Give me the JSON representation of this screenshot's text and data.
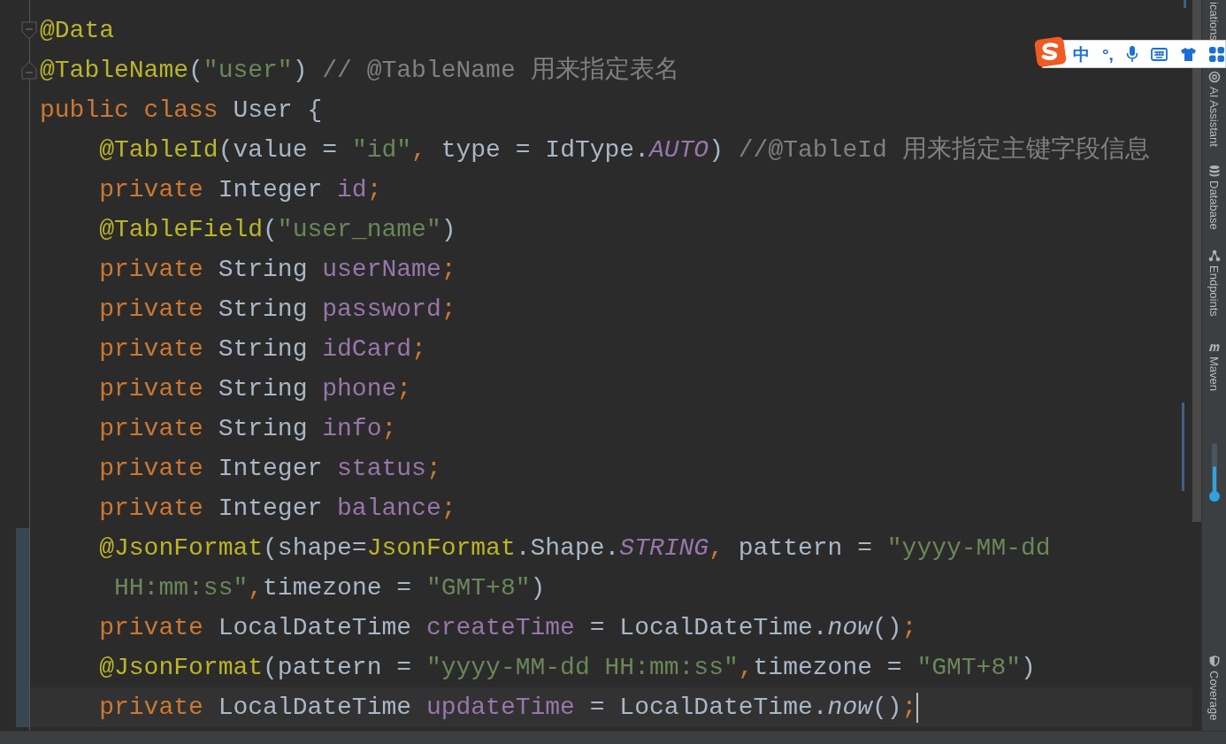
{
  "editor": {
    "lines": [
      {
        "tokens": [
          {
            "text": "@Data",
            "kind": "annotation"
          }
        ]
      },
      {
        "tokens": [
          {
            "text": "@TableName",
            "kind": "annotation"
          },
          {
            "text": "(",
            "kind": "plain"
          },
          {
            "text": "\"user\"",
            "kind": "string"
          },
          {
            "text": ") ",
            "kind": "plain"
          },
          {
            "text": "// @TableName 用来指定表名",
            "kind": "comment"
          }
        ]
      },
      {
        "tokens": [
          {
            "text": "public class ",
            "kind": "keyword"
          },
          {
            "text": "User {",
            "kind": "plain"
          }
        ]
      },
      {
        "tokens": [
          {
            "text": "    @TableId",
            "kind": "annotation"
          },
          {
            "text": "(value = ",
            "kind": "plain"
          },
          {
            "text": "\"id\"",
            "kind": "string"
          },
          {
            "text": ", ",
            "kind": "keyword"
          },
          {
            "text": "type = IdType.",
            "kind": "plain"
          },
          {
            "text": "AUTO",
            "kind": "constant"
          },
          {
            "text": ") ",
            "kind": "plain"
          },
          {
            "text": "//@TableId 用来指定主键字段信息",
            "kind": "comment"
          }
        ]
      },
      {
        "tokens": [
          {
            "text": "    private ",
            "kind": "keyword"
          },
          {
            "text": "Integer ",
            "kind": "plain"
          },
          {
            "text": "id",
            "kind": "field"
          },
          {
            "text": ";",
            "kind": "keyword"
          }
        ]
      },
      {
        "tokens": [
          {
            "text": "    @TableField",
            "kind": "annotation"
          },
          {
            "text": "(",
            "kind": "plain"
          },
          {
            "text": "\"user_name\"",
            "kind": "string"
          },
          {
            "text": ")",
            "kind": "plain"
          }
        ]
      },
      {
        "tokens": [
          {
            "text": "    private ",
            "kind": "keyword"
          },
          {
            "text": "String ",
            "kind": "plain"
          },
          {
            "text": "userName",
            "kind": "field"
          },
          {
            "text": ";",
            "kind": "keyword"
          }
        ]
      },
      {
        "tokens": [
          {
            "text": "    private ",
            "kind": "keyword"
          },
          {
            "text": "String ",
            "kind": "plain"
          },
          {
            "text": "password",
            "kind": "field"
          },
          {
            "text": ";",
            "kind": "keyword"
          }
        ]
      },
      {
        "tokens": [
          {
            "text": "    private ",
            "kind": "keyword"
          },
          {
            "text": "String ",
            "kind": "plain"
          },
          {
            "text": "idCard",
            "kind": "field"
          },
          {
            "text": ";",
            "kind": "keyword"
          }
        ]
      },
      {
        "tokens": [
          {
            "text": "    private ",
            "kind": "keyword"
          },
          {
            "text": "String ",
            "kind": "plain"
          },
          {
            "text": "phone",
            "kind": "field"
          },
          {
            "text": ";",
            "kind": "keyword"
          }
        ]
      },
      {
        "tokens": [
          {
            "text": "    private ",
            "kind": "keyword"
          },
          {
            "text": "String ",
            "kind": "plain"
          },
          {
            "text": "info",
            "kind": "field"
          },
          {
            "text": ";",
            "kind": "keyword"
          }
        ]
      },
      {
        "tokens": [
          {
            "text": "    private ",
            "kind": "keyword"
          },
          {
            "text": "Integer ",
            "kind": "plain"
          },
          {
            "text": "status",
            "kind": "field"
          },
          {
            "text": ";",
            "kind": "keyword"
          }
        ]
      },
      {
        "tokens": [
          {
            "text": "    private ",
            "kind": "keyword"
          },
          {
            "text": "Integer ",
            "kind": "plain"
          },
          {
            "text": "balance",
            "kind": "field"
          },
          {
            "text": ";",
            "kind": "keyword"
          }
        ]
      },
      {
        "modified": true,
        "tokens": [
          {
            "text": "    @JsonFormat",
            "kind": "annotation"
          },
          {
            "text": "(shape=",
            "kind": "plain"
          },
          {
            "text": "JsonFormat",
            "kind": "annotation"
          },
          {
            "text": ".Shape.",
            "kind": "plain"
          },
          {
            "text": "STRING",
            "kind": "constant"
          },
          {
            "text": ", ",
            "kind": "keyword"
          },
          {
            "text": "pattern = ",
            "kind": "plain"
          },
          {
            "text": "\"yyyy-MM-dd",
            "kind": "string"
          }
        ]
      },
      {
        "modified": true,
        "tokens": [
          {
            "text": "     HH:mm:ss\"",
            "kind": "string"
          },
          {
            "text": ",",
            "kind": "keyword"
          },
          {
            "text": "timezone = ",
            "kind": "plain"
          },
          {
            "text": "\"GMT+8\"",
            "kind": "string"
          },
          {
            "text": ")",
            "kind": "plain"
          }
        ]
      },
      {
        "modified": true,
        "tokens": [
          {
            "text": "    private ",
            "kind": "keyword"
          },
          {
            "text": "LocalDateTime ",
            "kind": "plain"
          },
          {
            "text": "createTime",
            "kind": "field"
          },
          {
            "text": " = LocalDateTime.",
            "kind": "plain"
          },
          {
            "text": "now",
            "kind": "static_call"
          },
          {
            "text": "()",
            "kind": "plain"
          },
          {
            "text": ";",
            "kind": "keyword"
          }
        ]
      },
      {
        "modified": true,
        "tokens": [
          {
            "text": "    @JsonFormat",
            "kind": "annotation"
          },
          {
            "text": "(pattern = ",
            "kind": "plain"
          },
          {
            "text": "\"yyyy-MM-dd HH:mm:ss\"",
            "kind": "string"
          },
          {
            "text": ",",
            "kind": "keyword"
          },
          {
            "text": "timezone = ",
            "kind": "plain"
          },
          {
            "text": "\"GMT+8\"",
            "kind": "string"
          },
          {
            "text": ")",
            "kind": "plain"
          }
        ]
      },
      {
        "modified": true,
        "current": true,
        "tokens": [
          {
            "text": "    private ",
            "kind": "keyword"
          },
          {
            "text": "LocalDateTime ",
            "kind": "plain"
          },
          {
            "text": "updateTime",
            "kind": "field"
          },
          {
            "text": " = LocalDateTime.",
            "kind": "plain"
          },
          {
            "text": "now",
            "kind": "static_call"
          },
          {
            "text": "()",
            "kind": "plain"
          },
          {
            "text": ";",
            "kind": "keyword"
          }
        ]
      }
    ]
  },
  "ime_toolbar": {
    "mode": "中",
    "punctuation": "°,"
  },
  "right_sidebar": {
    "tools": [
      {
        "label": "ications"
      },
      {
        "label": "AI Assistant"
      },
      {
        "label": "Database"
      },
      {
        "label": "Endpoints"
      },
      {
        "label": "Maven"
      }
    ],
    "slider": {
      "level": 0.6
    },
    "bottom_tools": [
      {
        "label": "Coverage"
      }
    ]
  }
}
